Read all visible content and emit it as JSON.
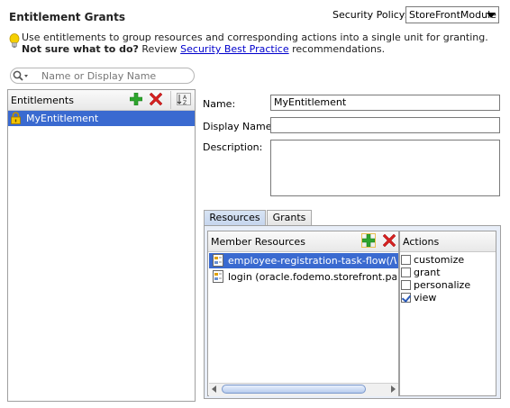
{
  "header": {
    "title": "Entitlement Grants",
    "policy_label": "Security Policy:",
    "policy_value": "StoreFrontModule"
  },
  "hint": {
    "line1": "Use entitlements to group resources and corresponding actions into a single unit for granting.",
    "line2_bold": "Not sure what to do?",
    "line2_pre": " Review ",
    "line2_link": "Security Best Practice",
    "line2_post": " recommendations."
  },
  "search": {
    "placeholder": "Name or Display Name"
  },
  "entitlements": {
    "header": "Entitlements",
    "items": [
      {
        "label": "MyEntitlement",
        "selected": true
      }
    ]
  },
  "form": {
    "name_label": "Name:",
    "name_value": "MyEntitlement",
    "display_label": "Display Name:",
    "display_value": "",
    "desc_label": "Description:",
    "desc_value": ""
  },
  "tabs": [
    {
      "label": "Resources",
      "active": true
    },
    {
      "label": "Grants",
      "active": false
    }
  ],
  "resources": {
    "header": "Member Resources",
    "items": [
      {
        "label": "employee-registration-task-flow(/WEB-INF/employee-registration-task-flow.xml)",
        "selected": true
      },
      {
        "label": "login (oracle.fodemo.storefront.pageDefs.loginPageDef)",
        "selected": false
      }
    ]
  },
  "actions": {
    "header": "Actions",
    "items": [
      {
        "label": "customize",
        "checked": false
      },
      {
        "label": "grant",
        "checked": false
      },
      {
        "label": "personalize",
        "checked": false
      },
      {
        "label": "view",
        "checked": true
      }
    ]
  },
  "colors": {
    "selection": "#3a6ad0",
    "link": "#0000cc",
    "add": "#2ea52e",
    "delete": "#d42020"
  }
}
